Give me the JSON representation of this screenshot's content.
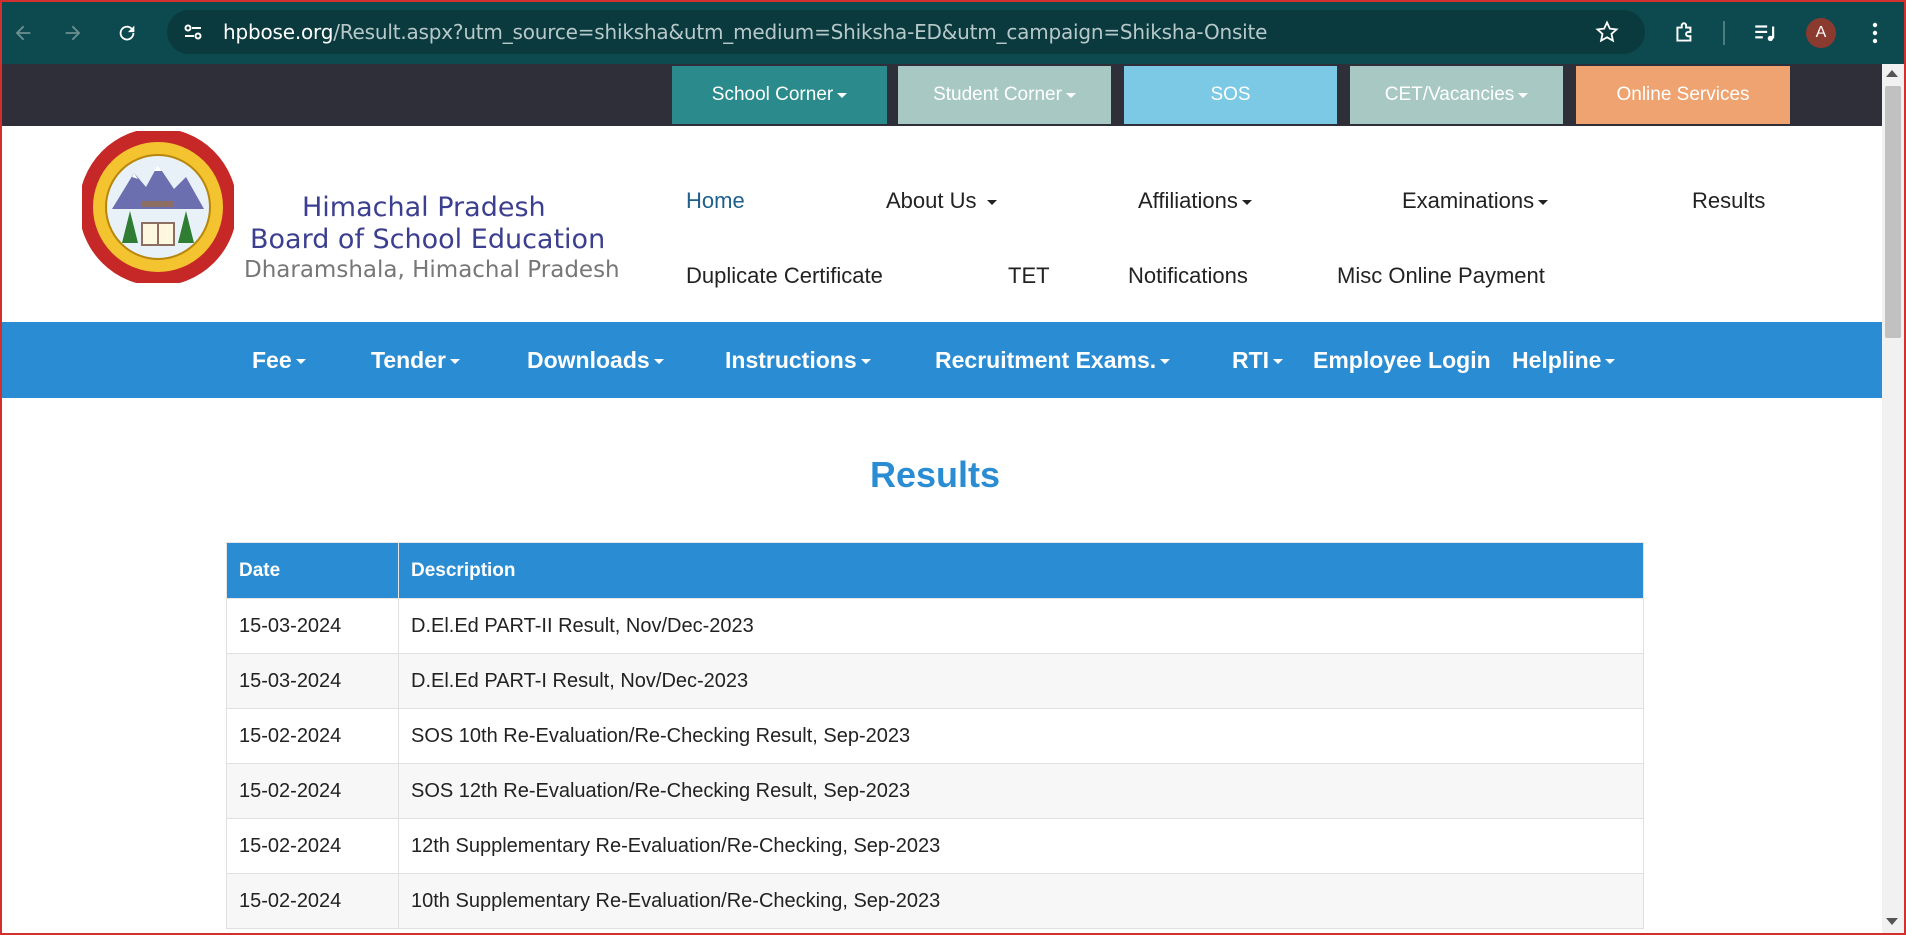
{
  "browser": {
    "url_domain": "hpbose.org",
    "url_path": "/Result.aspx?utm_source=shiksha&utm_medium=Shiksha-ED&utm_campaign=Shiksha-Onsite",
    "avatar_letter": "A",
    "icons": [
      "back-arrow-icon",
      "forward-arrow-icon",
      "reload-icon",
      "site-info-icon",
      "star-icon",
      "extensions-icon",
      "media-icon",
      "menu-icon"
    ]
  },
  "topbar": {
    "tabs": [
      {
        "label": "School Corner",
        "color": "#2a8a8c",
        "dropdown": true
      },
      {
        "label": "Student Corner",
        "color": "#a8c8c4",
        "dropdown": true
      },
      {
        "label": "SOS",
        "color": "#7bc9e4",
        "dropdown": false
      },
      {
        "label": "CET/Vacancies",
        "color": "#a8c8c4",
        "dropdown": true
      },
      {
        "label": "Online Services",
        "color": "#eea370",
        "dropdown": false
      }
    ]
  },
  "header": {
    "org_line1": "Himachal Pradesh",
    "org_line2": "Board of School Education",
    "org_line3": "Dharamshala, Himachal Pradesh",
    "nav": [
      {
        "label": "Home",
        "active": true
      },
      {
        "label": "About Us",
        "dropdown": true
      },
      {
        "label": "Affiliations",
        "dropdown": true
      },
      {
        "label": "Examinations",
        "dropdown": true
      },
      {
        "label": "Results"
      },
      {
        "label": "Duplicate Certificate"
      },
      {
        "label": "TET"
      },
      {
        "label": "Notifications"
      },
      {
        "label": "Misc Online Payment"
      }
    ]
  },
  "bluebar": {
    "items": [
      {
        "label": "Fee",
        "dropdown": true
      },
      {
        "label": "Tender",
        "dropdown": true
      },
      {
        "label": "Downloads",
        "dropdown": true
      },
      {
        "label": "Instructions",
        "dropdown": true
      },
      {
        "label": "Recruitment Exams.",
        "dropdown": true
      },
      {
        "label": "RTI",
        "dropdown": true
      },
      {
        "label": "Employee Login",
        "dropdown": false
      },
      {
        "label": "Helpline",
        "dropdown": true
      }
    ]
  },
  "results": {
    "title": "Results",
    "columns": [
      "Date",
      "Description"
    ],
    "rows": [
      {
        "date": "15-03-2024",
        "description": "D.El.Ed PART-II Result, Nov/Dec-2023"
      },
      {
        "date": "15-03-2024",
        "description": "D.El.Ed PART-I Result, Nov/Dec-2023"
      },
      {
        "date": "15-02-2024",
        "description": "SOS 10th Re-Evaluation/Re-Checking Result, Sep-2023"
      },
      {
        "date": "15-02-2024",
        "description": "SOS 12th Re-Evaluation/Re-Checking Result, Sep-2023"
      },
      {
        "date": "15-02-2024",
        "description": "12th Supplementary Re-Evaluation/Re-Checking, Sep-2023"
      },
      {
        "date": "15-02-2024",
        "description": "10th Supplementary Re-Evaluation/Re-Checking, Sep-2023"
      }
    ]
  }
}
